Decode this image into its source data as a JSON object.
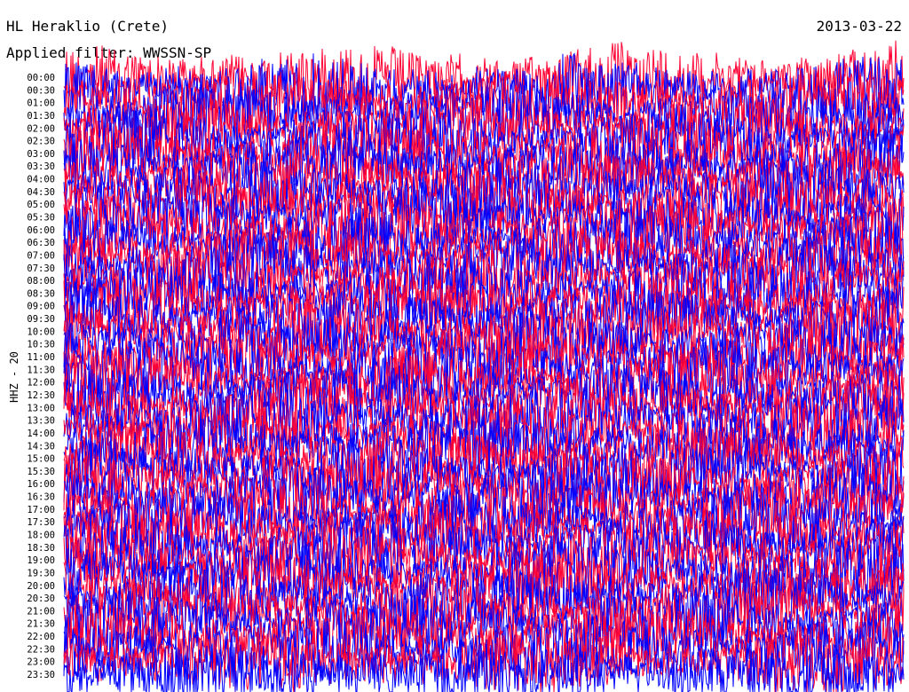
{
  "header": {
    "station": "HL Heraklio (Crete)",
    "date": "2013-03-22",
    "filter": "Applied filter: WWSSN-SP"
  },
  "chart_data": {
    "type": "line",
    "title": "HL Heraklio (Crete)",
    "subtitle": "Applied filter: WWSSN-SP",
    "ylabel": "HHZ - 20",
    "xlabel": "",
    "row_labels": [
      "00:00",
      "00:30",
      "01:00",
      "01:30",
      "02:00",
      "02:30",
      "03:00",
      "03:30",
      "04:00",
      "04:30",
      "05:00",
      "05:30",
      "06:00",
      "06:30",
      "07:00",
      "07:30",
      "08:00",
      "08:30",
      "09:00",
      "09:30",
      "10:00",
      "10:30",
      "11:00",
      "11:30",
      "12:00",
      "12:30",
      "13:00",
      "13:30",
      "14:00",
      "14:30",
      "15:00",
      "15:30",
      "16:00",
      "16:30",
      "17:00",
      "17:30",
      "18:00",
      "18:30",
      "19:00",
      "19:30",
      "20:00",
      "20:30",
      "21:00",
      "21:30",
      "22:00",
      "22:30",
      "23:00",
      "23:30"
    ],
    "series_colors": [
      "#ff0033",
      "#0000ff"
    ],
    "minutes_per_row": 30
  }
}
